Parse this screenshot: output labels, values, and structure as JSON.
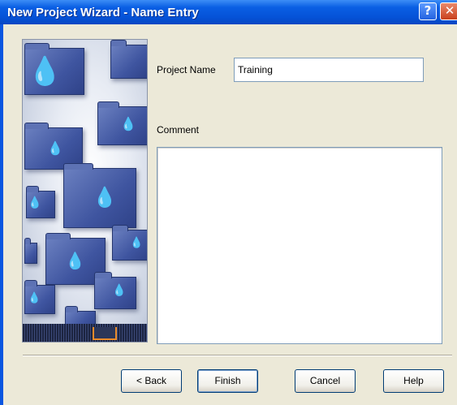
{
  "window": {
    "title": "New Project Wizard - Name Entry",
    "help_glyph": "?",
    "close_glyph": "✕"
  },
  "form": {
    "project_name_label": "Project Name",
    "project_name_value": "Training",
    "comment_label": "Comment",
    "comment_value": ""
  },
  "buttons": {
    "back": "< Back",
    "finish": "Finish",
    "cancel": "Cancel",
    "help": "Help"
  },
  "icons": {
    "wizard_art": "folders-with-drops-illustration",
    "help": "question-icon",
    "close": "close-icon"
  }
}
